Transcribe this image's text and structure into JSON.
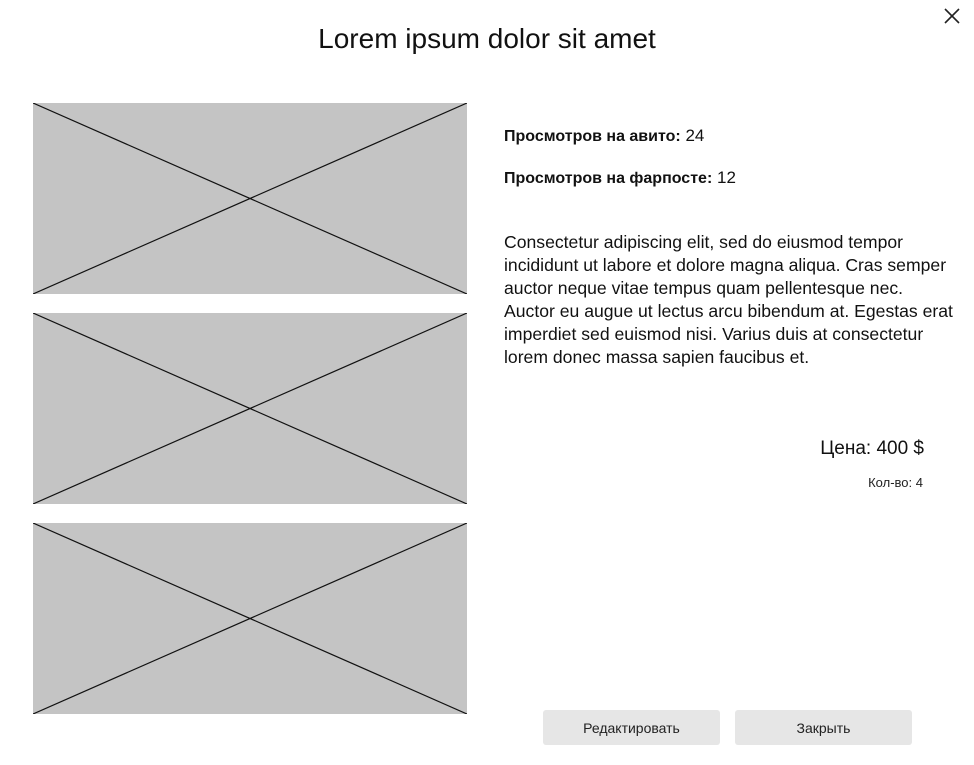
{
  "title": "Lorem ipsum dolor sit amet",
  "close_icon": "close-icon",
  "images": [
    {
      "name": "image-placeholder-1",
      "fill": "#c4c4c4"
    },
    {
      "name": "image-placeholder-2",
      "fill": "#c4c4c4"
    },
    {
      "name": "image-placeholder-3",
      "fill": "#c4c4c4"
    }
  ],
  "stats": {
    "avito_label": "Просмотров на авито:",
    "avito_value": "24",
    "farpost_label": "Просмотров на фарпосте:",
    "farpost_value": "12"
  },
  "description": "Consectetur adipiscing elit, sed do eiusmod tempor incididunt ut labore et dolore magna aliqua. Cras semper auctor neque vitae tempus quam pellentesque nec. Auctor eu augue ut lectus arcu bibendum at. Egestas erat imperdiet sed euismod nisi. Varius duis at consectetur lorem donec massa sapien faucibus et.",
  "price": "Цена: 400 $",
  "quantity": "Кол-во: 4",
  "buttons": {
    "edit_label": "Редактировать",
    "close_label": "Закрыть",
    "color": "#e6e6e6"
  }
}
